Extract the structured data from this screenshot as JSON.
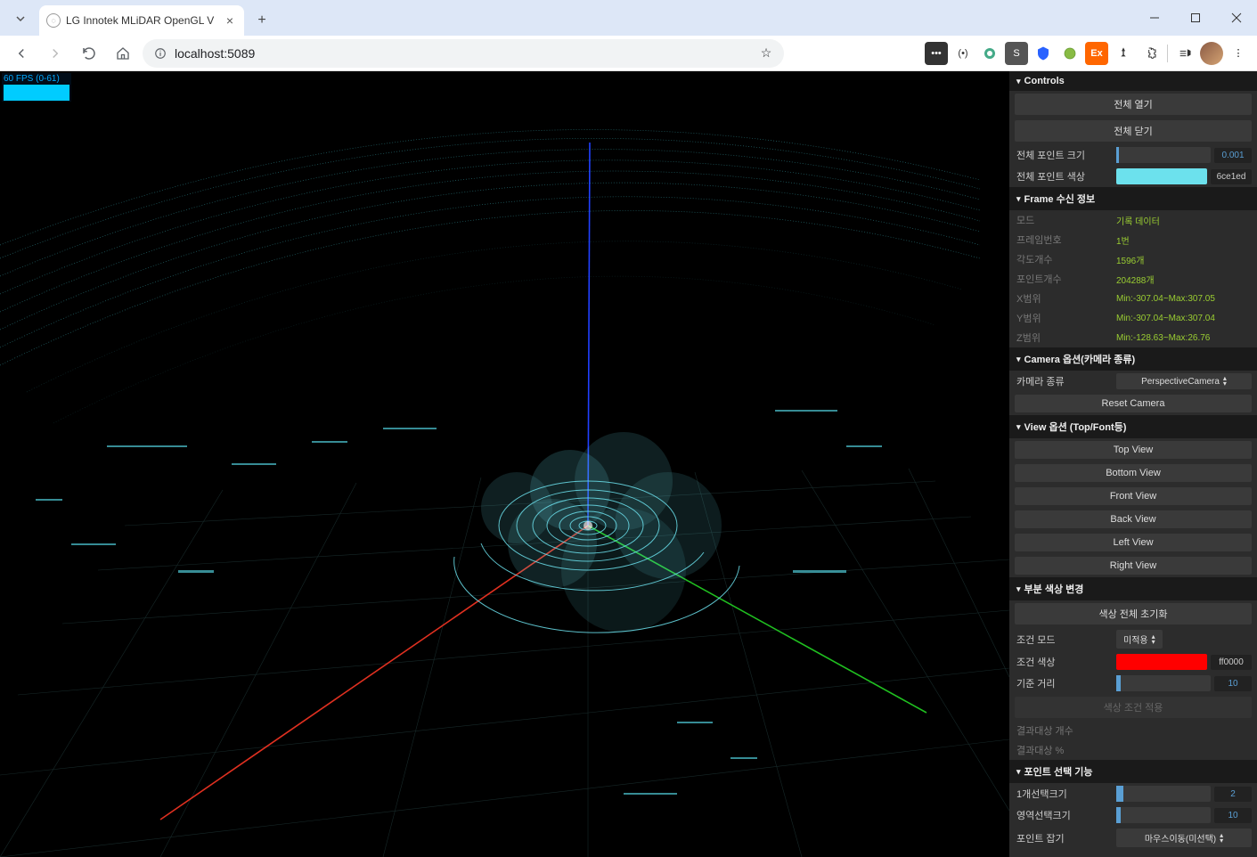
{
  "browser": {
    "tab_title": "LG Innotek MLiDAR OpenGL V",
    "url": "localhost:5089"
  },
  "fps": "60 FPS (0-61)",
  "panel": {
    "controls": {
      "header": "Controls",
      "open_all": "전체 열기",
      "close_all": "전체 닫기",
      "point_size_label": "전체 포인트 크기",
      "point_size_value": "0.001",
      "point_color_label": "전체 포인트 색상",
      "point_color_hex": "6ce1ed"
    },
    "frame": {
      "header": "Frame 수신 정보",
      "mode_label": "모드",
      "mode_value": "기록 데이터",
      "frame_no_label": "프레임번호",
      "frame_no_value": "1번",
      "angle_count_label": "각도개수",
      "angle_count_value": "1596개",
      "point_count_label": "포인트개수",
      "point_count_value": "204288개",
      "x_range_label": "X범위",
      "x_range_value": "Min:-307.04~Max:307.05",
      "y_range_label": "Y범위",
      "y_range_value": "Min:-307.04~Max:307.04",
      "z_range_label": "Z범위",
      "z_range_value": "Min:-128.63~Max:26.76"
    },
    "camera": {
      "header": "Camera 옵션(카메라 종류)",
      "type_label": "카메라 종류",
      "type_value": "PerspectiveCamera",
      "reset": "Reset Camera"
    },
    "view": {
      "header": "View 옵션 (Top/Font등)",
      "top": "Top View",
      "bottom": "Bottom View",
      "front": "Front View",
      "back": "Back View",
      "left": "Left View",
      "right": "Right View"
    },
    "partial_color": {
      "header": "부분 색상 변경",
      "reset": "색상 전체 초기화",
      "mode_label": "조건 모드",
      "mode_value": "미적용",
      "color_label": "조건 색상",
      "color_hex": "ff0000",
      "distance_label": "기준 거리",
      "distance_value": "10",
      "apply": "색상 조건 적용",
      "result_count_label": "결과대상 개수",
      "result_pct_label": "결과대상 %"
    },
    "point_select": {
      "header": "포인트 선택 기능",
      "single_label": "1개선택크기",
      "single_value": "2",
      "area_label": "영역선택크기",
      "area_value": "10",
      "grab_label": "포인트 잡기",
      "grab_value": "마우스이동(미선택)"
    }
  }
}
